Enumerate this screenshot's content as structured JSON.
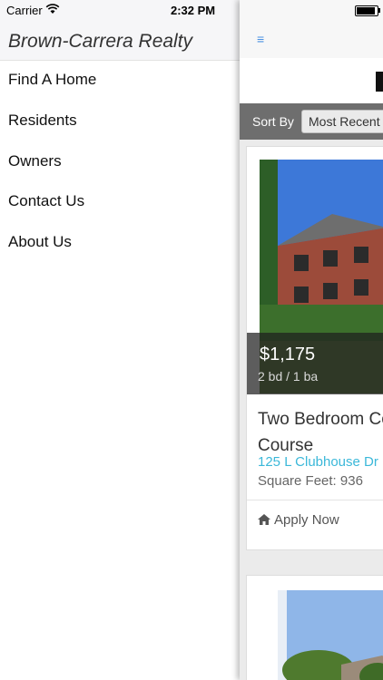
{
  "status_bar": {
    "carrier": "Carrier",
    "time": "2:32 PM"
  },
  "menu": {
    "title": "Brown-Carrera Realty",
    "items": [
      {
        "label": "Find A Home"
      },
      {
        "label": "Residents"
      },
      {
        "label": "Owners"
      },
      {
        "label": "Contact Us"
      },
      {
        "label": "About Us"
      }
    ]
  },
  "panel": {
    "nav_icon": "hamburger-icon",
    "sort": {
      "label": "Sort By",
      "selected": "Most Recent"
    },
    "listings": [
      {
        "price": "$1,175",
        "beds": "2 bd / 1 ba",
        "title": "Two Bedroom Co… Course",
        "title_line1": "Two Bedroom Co",
        "title_line2": "Course",
        "address": "125 L Clubhouse Dr",
        "square_feet": "Square Feet: 936",
        "apply_label": "Apply Now"
      }
    ]
  },
  "colors": {
    "accent_link": "#3bb8d9",
    "sort_bar": "#6e6e6e",
    "menu_header": "#f6f6f8"
  }
}
